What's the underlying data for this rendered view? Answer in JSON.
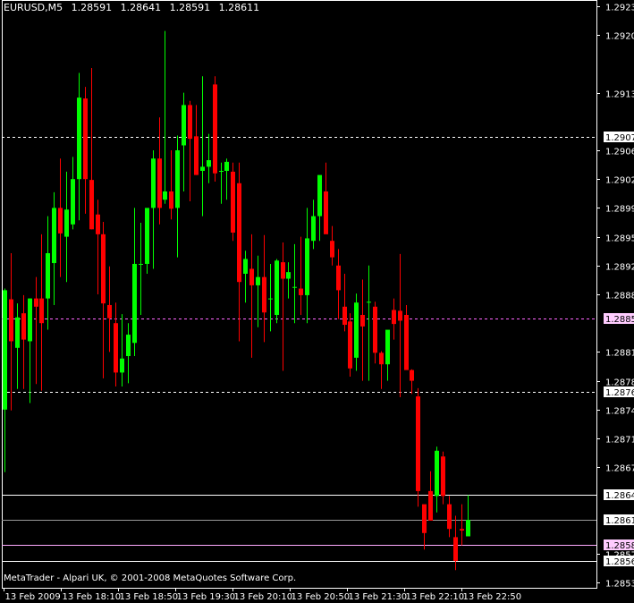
{
  "header": {
    "symbol": "EURUSD,M5",
    "open": "1.28591",
    "high": "1.28641",
    "low": "1.28591",
    "close": "1.28611"
  },
  "footer": {
    "copyright": "MetaTrader - Alpari UK, © 2001-2008 MetaQuotes Software Corp."
  },
  "colors": {
    "background": "#000000",
    "axis": "#ffffff",
    "bull": "#00ff00",
    "bear": "#ff0000",
    "box_bull": "#00ff00",
    "box_bear": "#ff0000",
    "level": "#ffffff",
    "pink": "#ff00ff"
  },
  "chart_data": {
    "type": "candlestick",
    "ylim": [
      1.28535,
      1.29235
    ],
    "y_ticks": [
      "1.29235",
      "1.29200",
      "1.29130",
      "1.29060",
      "1.29025",
      "1.28990",
      "1.28955",
      "1.28920",
      "1.28885",
      "1.28815",
      "1.28780",
      "1.28745",
      "1.28710",
      "1.28675",
      "1.28570",
      "1.28535"
    ],
    "x_ticks": [
      "13 Feb 2009",
      "13 Feb 18:10",
      "13 Feb 18:50",
      "13 Feb 19:30",
      "13 Feb 20:10",
      "13 Feb 20:50",
      "13 Feb 21:30",
      "13 Feb 22:10",
      "13 Feb 22:50"
    ],
    "candles": [
      {
        "o": 1.28745,
        "h": 1.28892,
        "l": 1.28669,
        "c": 1.2889
      },
      {
        "o": 1.28879,
        "h": 1.28935,
        "l": 1.28744,
        "c": 1.28828
      },
      {
        "o": 1.2882,
        "h": 1.28874,
        "l": 1.2877,
        "c": 1.28857
      },
      {
        "o": 1.28862,
        "h": 1.28884,
        "l": 1.2877,
        "c": 1.2883
      },
      {
        "o": 1.28828,
        "h": 1.2888,
        "l": 1.28753,
        "c": 1.2888
      },
      {
        "o": 1.2888,
        "h": 1.28906,
        "l": 1.28776,
        "c": 1.2887
      },
      {
        "o": 1.2888,
        "h": 1.28958,
        "l": 1.28768,
        "c": 1.2885
      },
      {
        "o": 1.2888,
        "h": 1.2898,
        "l": 1.28842,
        "c": 1.28935
      },
      {
        "o": 1.28923,
        "h": 1.29009,
        "l": 1.28872,
        "c": 1.2899
      },
      {
        "o": 1.2899,
        "h": 1.2905,
        "l": 1.28906,
        "c": 1.28959
      },
      {
        "o": 1.28955,
        "h": 1.29034,
        "l": 1.289,
        "c": 1.28988
      },
      {
        "o": 1.2897,
        "h": 1.29052,
        "l": 1.28964,
        "c": 1.29025
      },
      {
        "o": 1.29025,
        "h": 1.29154,
        "l": 1.28975,
        "c": 1.29124
      },
      {
        "o": 1.29123,
        "h": 1.29137,
        "l": 1.28983,
        "c": 1.29025
      },
      {
        "o": 1.29024,
        "h": 1.2916,
        "l": 1.28964,
        "c": 1.28964
      },
      {
        "o": 1.28982,
        "h": 1.29,
        "l": 1.28885,
        "c": 1.28958
      },
      {
        "o": 1.28958,
        "h": 1.28973,
        "l": 1.28783,
        "c": 1.28874
      },
      {
        "o": 1.28872,
        "h": 1.28919,
        "l": 1.28815,
        "c": 1.28856
      },
      {
        "o": 1.2885,
        "h": 1.28875,
        "l": 1.28773,
        "c": 1.2879
      },
      {
        "o": 1.2879,
        "h": 1.28861,
        "l": 1.28773,
        "c": 1.28807
      },
      {
        "o": 1.2881,
        "h": 1.2885,
        "l": 1.28777,
        "c": 1.28836
      },
      {
        "o": 1.28826,
        "h": 1.2899,
        "l": 1.2881,
        "c": 1.28922
      },
      {
        "o": 1.28922,
        "h": 1.28972,
        "l": 1.2886,
        "c": 1.28922
      },
      {
        "o": 1.28922,
        "h": 1.28989,
        "l": 1.2891,
        "c": 1.2899
      },
      {
        "o": 1.2899,
        "h": 1.2906,
        "l": 1.28916,
        "c": 1.2905
      },
      {
        "o": 1.2905,
        "h": 1.291,
        "l": 1.2897,
        "c": 1.2899
      },
      {
        "o": 1.29,
        "h": 1.29205,
        "l": 1.28995,
        "c": 1.2901
      },
      {
        "o": 1.2901,
        "h": 1.2906,
        "l": 1.28976,
        "c": 1.28989
      },
      {
        "o": 1.2899,
        "h": 1.29078,
        "l": 1.2893,
        "c": 1.2906
      },
      {
        "o": 1.29066,
        "h": 1.2913,
        "l": 1.2901,
        "c": 1.29115
      },
      {
        "o": 1.29115,
        "h": 1.2912,
        "l": 1.28998,
        "c": 1.29074
      },
      {
        "o": 1.29077,
        "h": 1.29115,
        "l": 1.2903,
        "c": 1.2903
      },
      {
        "o": 1.29035,
        "h": 1.2915,
        "l": 1.2898,
        "c": 1.2904
      },
      {
        "o": 1.2904,
        "h": 1.2908,
        "l": 1.2902,
        "c": 1.29048
      },
      {
        "o": 1.2914,
        "h": 1.2915,
        "l": 1.29022,
        "c": 1.29032
      },
      {
        "o": 1.29035,
        "h": 1.29045,
        "l": 1.28995,
        "c": 1.29035
      },
      {
        "o": 1.29035,
        "h": 1.2905,
        "l": 1.29,
        "c": 1.29046
      },
      {
        "o": 1.29034,
        "h": 1.29045,
        "l": 1.2895,
        "c": 1.2896
      },
      {
        "o": 1.2902,
        "h": 1.29045,
        "l": 1.28828,
        "c": 1.289
      },
      {
        "o": 1.2891,
        "h": 1.28938,
        "l": 1.28875,
        "c": 1.28928
      },
      {
        "o": 1.28916,
        "h": 1.28958,
        "l": 1.28808,
        "c": 1.28896
      },
      {
        "o": 1.28896,
        "h": 1.28932,
        "l": 1.28845,
        "c": 1.28906
      },
      {
        "o": 1.28906,
        "h": 1.28957,
        "l": 1.28827,
        "c": 1.28863
      },
      {
        "o": 1.2888,
        "h": 1.28922,
        "l": 1.2884,
        "c": 1.2888
      },
      {
        "o": 1.2886,
        "h": 1.28928,
        "l": 1.2885,
        "c": 1.28926
      },
      {
        "o": 1.28924,
        "h": 1.28948,
        "l": 1.28792,
        "c": 1.28904
      },
      {
        "o": 1.28904,
        "h": 1.28924,
        "l": 1.2888,
        "c": 1.28912
      },
      {
        "o": 1.28894,
        "h": 1.28946,
        "l": 1.2885,
        "c": 1.28894
      },
      {
        "o": 1.28892,
        "h": 1.28955,
        "l": 1.2886,
        "c": 1.28884
      },
      {
        "o": 1.28884,
        "h": 1.2899,
        "l": 1.2885,
        "c": 1.28953
      },
      {
        "o": 1.2895,
        "h": 1.29,
        "l": 1.2894,
        "c": 1.2898
      },
      {
        "o": 1.2898,
        "h": 1.29025,
        "l": 1.2895,
        "c": 1.2903
      },
      {
        "o": 1.2901,
        "h": 1.29045,
        "l": 1.28972,
        "c": 1.28958
      },
      {
        "o": 1.2895,
        "h": 1.28968,
        "l": 1.2892,
        "c": 1.2893
      },
      {
        "o": 1.2892,
        "h": 1.2894,
        "l": 1.28855,
        "c": 1.2889
      },
      {
        "o": 1.2887,
        "h": 1.2891,
        "l": 1.2884,
        "c": 1.28848
      },
      {
        "o": 1.28852,
        "h": 1.28862,
        "l": 1.28785,
        "c": 1.28795
      },
      {
        "o": 1.28808,
        "h": 1.28886,
        "l": 1.28792,
        "c": 1.28875
      },
      {
        "o": 1.2886,
        "h": 1.28903,
        "l": 1.2878,
        "c": 1.28846
      },
      {
        "o": 1.28876,
        "h": 1.2892,
        "l": 1.2878,
        "c": 1.28876
      },
      {
        "o": 1.2887,
        "h": 1.28876,
        "l": 1.28801,
        "c": 1.28814
      },
      {
        "o": 1.28814,
        "h": 1.28816,
        "l": 1.2877,
        "c": 1.288
      },
      {
        "o": 1.288,
        "h": 1.28836,
        "l": 1.2878,
        "c": 1.28842
      },
      {
        "o": 1.28866,
        "h": 1.2888,
        "l": 1.2883,
        "c": 1.28849
      },
      {
        "o": 1.28865,
        "h": 1.28934,
        "l": 1.2876,
        "c": 1.28853
      },
      {
        "o": 1.2886,
        "h": 1.28872,
        "l": 1.28808,
        "c": 1.28793
      },
      {
        "o": 1.28793,
        "h": 1.28794,
        "l": 1.28764,
        "c": 1.2878
      },
      {
        "o": 1.28761,
        "h": 1.28771,
        "l": 1.28627,
        "c": 1.28646
      },
      {
        "o": 1.2863,
        "h": 1.2862,
        "l": 1.28575,
        "c": 1.28595
      },
      {
        "o": 1.28646,
        "h": 1.2867,
        "l": 1.28617,
        "c": 1.2861
      },
      {
        "o": 1.2864,
        "h": 1.287,
        "l": 1.2862,
        "c": 1.28695
      },
      {
        "o": 1.28688,
        "h": 1.28694,
        "l": 1.2863,
        "c": 1.2864
      },
      {
        "o": 1.2863,
        "h": 1.2864,
        "l": 1.2859,
        "c": 1.286
      },
      {
        "o": 1.2859,
        "h": 1.28616,
        "l": 1.2855,
        "c": 1.28561
      },
      {
        "o": 1.286,
        "h": 1.2863,
        "l": 1.2858,
        "c": 1.28598
      },
      {
        "o": 1.28591,
        "h": 1.28641,
        "l": 1.28591,
        "c": 1.28611
      }
    ],
    "horizontal_levels": [
      {
        "price": "1.29076",
        "style": "dashed",
        "color": "#ffffff",
        "label_bg": "#ffffff"
      },
      {
        "price": "1.28856",
        "style": "dashed",
        "color": "#ff66ff",
        "label_bg": "#ffccff"
      },
      {
        "price": "1.28766",
        "style": "dashed",
        "color": "#ffffff",
        "label_bg": "#ffffff"
      },
      {
        "price": "1.28641",
        "style": "solid",
        "color": "#ffffff",
        "label_bg": "#ffffff"
      },
      {
        "price": "1.28611",
        "style": "solid",
        "color": "#999999",
        "label_bg": "#ffffff"
      },
      {
        "price": "1.28581",
        "style": "solid",
        "color": "#ffaaff",
        "label_bg": "#ffccff"
      },
      {
        "price": "1.28561",
        "style": "solid",
        "color": "#ffffff",
        "label_bg": "#ffffff"
      }
    ],
    "grid": false
  }
}
